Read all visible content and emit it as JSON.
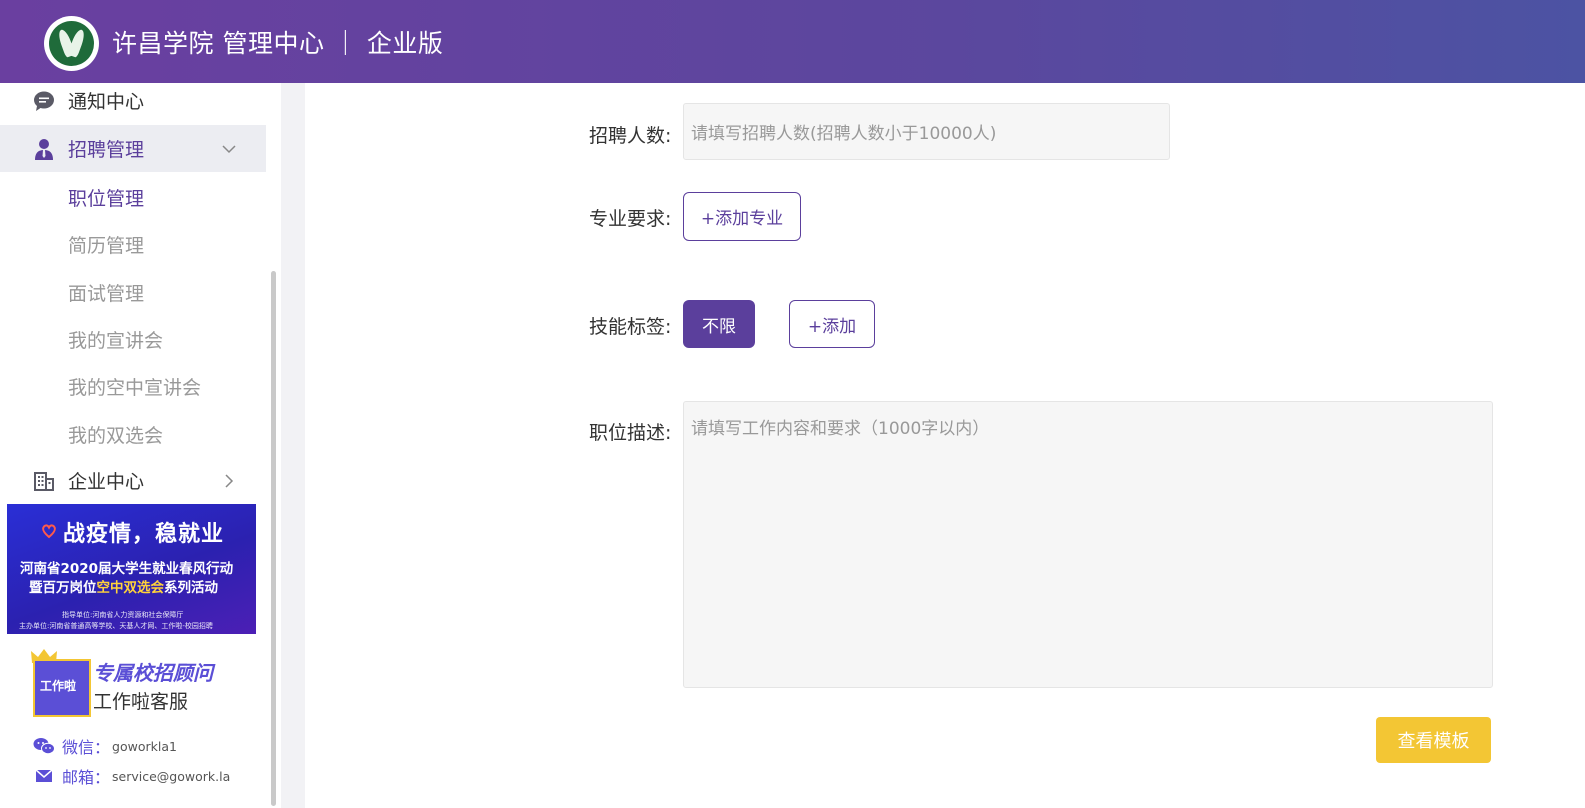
{
  "colors": {
    "header_start": "#6a3fa0",
    "header_end": "#4c53a3",
    "accent": "#5b3f9c",
    "button_yellow": "#f3c634",
    "banner_blue": "#2b21b0"
  },
  "header": {
    "title": "许昌学院 管理中心 ｜ 企业版",
    "logo_icon": "university-logo-icon"
  },
  "sidebar": {
    "items": [
      {
        "label": "通知中心",
        "icon": "chat-bubble-icon"
      },
      {
        "label": "招聘管理",
        "icon": "person-icon",
        "arrow": "chevron-down-icon"
      },
      {
        "label": "企业中心",
        "icon": "building-icon",
        "arrow": "chevron-right-icon"
      }
    ],
    "sub_items": [
      "职位管理",
      "简历管理",
      "面试管理",
      "我的宣讲会",
      "我的空中宣讲会",
      "我的双选会"
    ],
    "banner": {
      "title": "战疫情，稳就业",
      "line1": "河南省2020届大学生就业春风行动",
      "line2_prefix": "暨百万岗位",
      "line2_highlight": "空中双选会",
      "line2_suffix": "系列活动",
      "small1": "指导单位:河南省人力资源和社会保障厅",
      "small2": "主办单位:河南省普通高等学校、天基人才网、工作啦-校园招聘"
    },
    "advisor": {
      "logo_text": "工作啦",
      "title": "专属校招顾问",
      "subtitle": "工作啦客服"
    },
    "contacts": [
      {
        "label": "微信：",
        "value": "goworkla1",
        "icon": "wechat-icon"
      },
      {
        "label": "邮箱：",
        "value": "service@gowork.la",
        "icon": "mail-icon"
      }
    ]
  },
  "form": {
    "headcount": {
      "label": "招聘人数:",
      "placeholder": "请填写招聘人数(招聘人数小于10000人)"
    },
    "major": {
      "label": "专业要求:",
      "add_button": "+添加专业"
    },
    "skills": {
      "label": "技能标签:",
      "selected_tag": "不限",
      "add_button": "+添加"
    },
    "description": {
      "label": "职位描述:",
      "placeholder": "请填写工作内容和要求（1000字以内）"
    },
    "template_button": "查看模板"
  }
}
